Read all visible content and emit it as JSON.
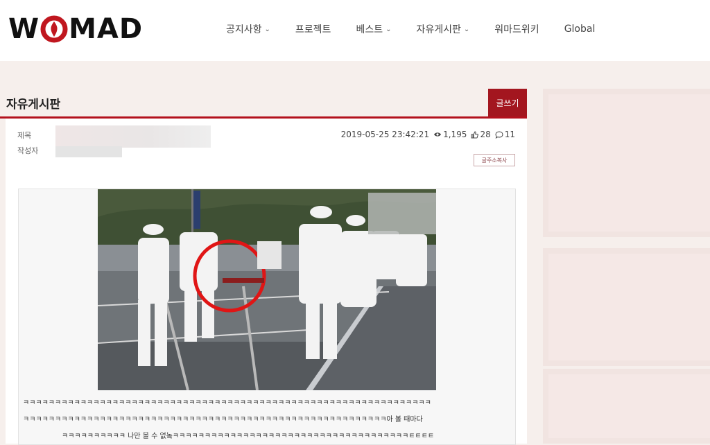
{
  "brand": {
    "logo_text_left": "W",
    "logo_text_right": "MAD",
    "accent_color": "#b3111d"
  },
  "nav": {
    "items": [
      {
        "label": "공지사항",
        "has_dropdown": true
      },
      {
        "label": "프로젝트",
        "has_dropdown": false
      },
      {
        "label": "베스트",
        "has_dropdown": true
      },
      {
        "label": "자유게시판",
        "has_dropdown": true
      },
      {
        "label": "워마드위키",
        "has_dropdown": false
      },
      {
        "label": "Global",
        "has_dropdown": false
      }
    ]
  },
  "board": {
    "title": "자유게시판",
    "write_button": "글쓰기"
  },
  "post": {
    "title_label": "제목",
    "author_label": "작성자",
    "datetime": "2019-05-25 23:42:21",
    "views": "1,195",
    "likes": "28",
    "comments": "11",
    "copy_button": "글주소복사",
    "body_lines": [
      "ㅋㅋㅋㅋㅋㅋㅋㅋㅋㅋㅋㅋㅋㅋㅋㅋㅋㅋㅋㅋㅋㅋㅋㅋㅋㅋㅋㅋㅋㅋㅋㅋㅋㅋㅋㅋㅋㅋㅋㅋㅋㅋㅋㅋㅋㅋㅋㅋㅋㅋㅋㅋㅋㅋㅋㅋㅋㅋㅋㅋㅋㅋㅋㅋ",
      "ㅋㅋㅋㅋㅋㅋㅋㅋㅋㅋㅋㅋㅋㅋㅋㅋㅋㅋㅋㅋㅋㅋㅋㅋㅋㅋㅋㅋㅋㅋㅋㅋㅋㅋㅋㅋㅋㅋㅋㅋㅋㅋㅋㅋㅋㅋㅋㅋㅋㅋㅋㅋㅋㅋㅋㅋㅋ아 볼 때마다",
      "ㅋㅋㅋㅋㅋㅋㅋㅋㅋㅋ 나만 볼 수 없놐ㅋㅋㅋㅋㅋㅋㅋㅋㅋㅋㅋㅋㅋㅋㅋㅋㅋㅋㅋㅋㅋㅋㅋㅋㅋㅋㅋㅋㅋㅋㅋㅋㅋㅋㅋㅋㅋㅌㅌㅌㅌ"
    ]
  },
  "icons": {
    "views": "eye-icon",
    "likes": "thumbs-up-icon",
    "comments": "comment-icon"
  }
}
